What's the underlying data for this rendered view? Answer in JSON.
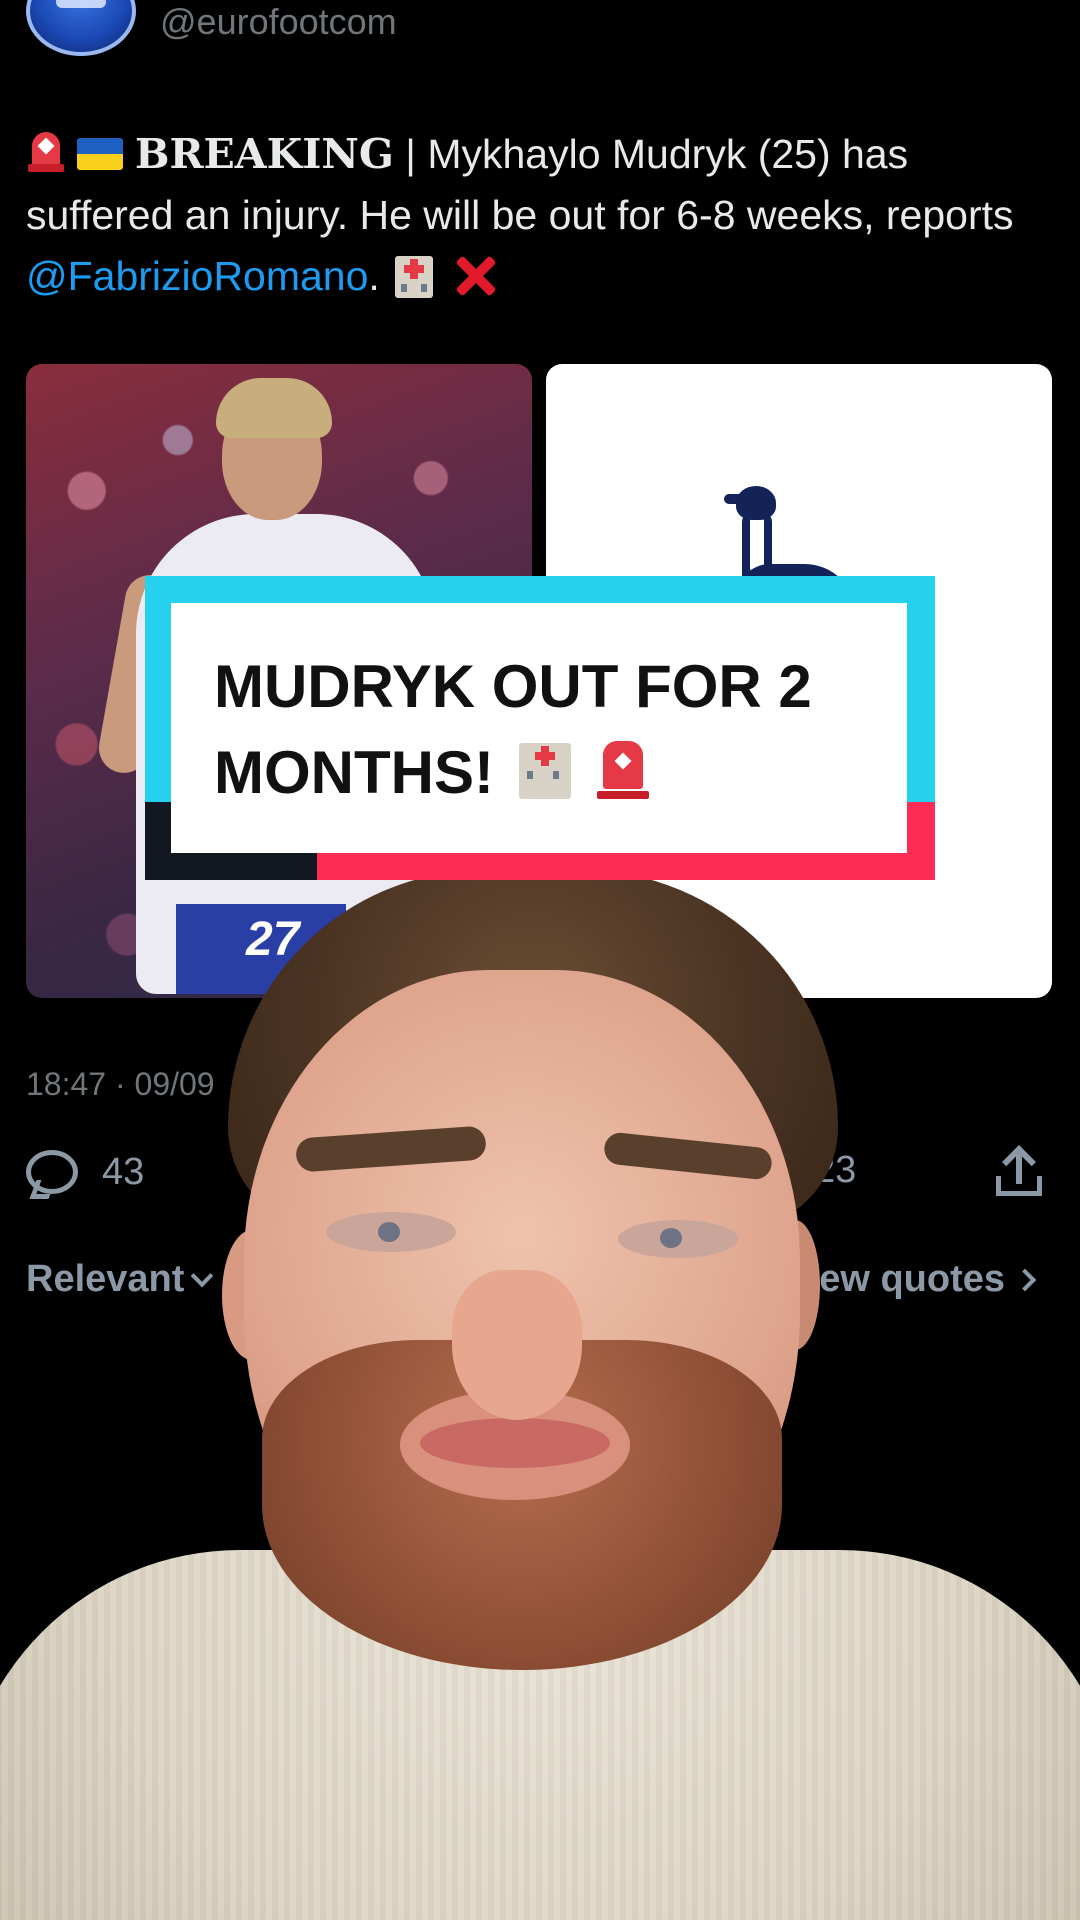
{
  "tweet": {
    "handle": "@eurofootcom",
    "text_bold": "BREAKING",
    "text_sep": " | ",
    "text_main": "Mykhaylo Mudryk (25) has suffered an injury. He will be out for 6-8 weeks, reports ",
    "mention": "@FabrizioRomano",
    "text_end": ". ",
    "timestamp": "18:47 · 09/09",
    "reply_count": "43",
    "bookmark_count": "23",
    "sort_label": "Relevant",
    "view_quotes_label": "View quotes"
  },
  "caption": {
    "text": "MUDRYK OUT FOR 2 MONTHS!"
  },
  "media": {
    "photo_shirt_number": "27"
  },
  "icons": {
    "siren": "siren-icon",
    "flag": "ukraine-flag-icon",
    "hospital": "hospital-icon",
    "cross": "red-x-icon",
    "reply": "reply-icon",
    "bookmark": "bookmark-icon",
    "share": "share-icon"
  },
  "colors": {
    "background": "#000000",
    "text": "#e7e9ea",
    "muted": "#71767b",
    "link": "#1d9bf0",
    "caption_cyan": "#25d1ec",
    "caption_pink": "#fe2c55"
  }
}
